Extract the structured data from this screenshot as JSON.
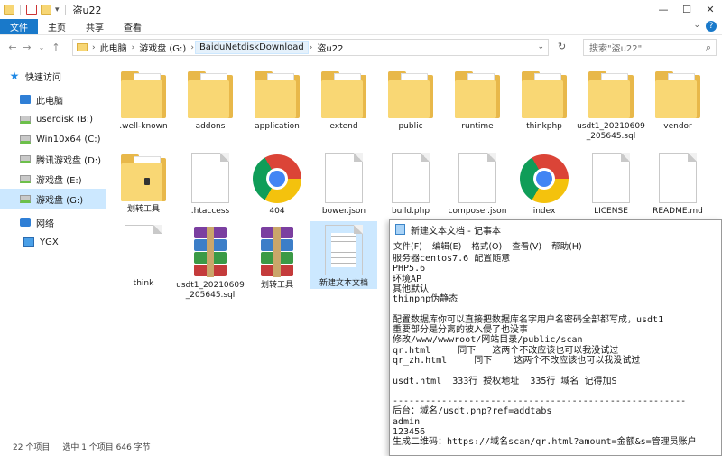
{
  "window": {
    "title": "盗u22",
    "controls": [
      "—",
      "☐",
      "✕"
    ]
  },
  "ribbon": {
    "tabs": [
      "文件",
      "主页",
      "共享",
      "查看"
    ],
    "help": "?"
  },
  "address": {
    "crumbs": [
      "此电脑",
      "游戏盘 (G:)",
      "BaiduNetdiskDownload",
      "盗u22"
    ],
    "search_placeholder": "搜索\"盗u22\""
  },
  "sidebar": {
    "items": [
      {
        "label": "快速访问",
        "icon": "star-icon"
      },
      {
        "label": "此电脑",
        "icon": "computer-icon"
      },
      {
        "label": "userdisk (B:)",
        "icon": "drive-icon"
      },
      {
        "label": "Win10x64 (C:)",
        "icon": "drive-icon"
      },
      {
        "label": "腾讯游戏盘 (D:)",
        "icon": "drive-icon"
      },
      {
        "label": "游戏盘 (E:)",
        "icon": "drive-icon"
      },
      {
        "label": "游戏盘 (G:)",
        "icon": "drive-icon"
      },
      {
        "label": "网络",
        "icon": "network-icon"
      },
      {
        "label": "YGX",
        "icon": "monitor-icon"
      }
    ]
  },
  "files": [
    {
      "name": ".well-known",
      "type": "folder"
    },
    {
      "name": "addons",
      "type": "folder"
    },
    {
      "name": "application",
      "type": "folder"
    },
    {
      "name": "extend",
      "type": "folder"
    },
    {
      "name": "public",
      "type": "folder"
    },
    {
      "name": "runtime",
      "type": "folder"
    },
    {
      "name": "thinkphp",
      "type": "folder"
    },
    {
      "name": "usdt1_20210609_205645.sql",
      "type": "folder"
    },
    {
      "name": "vendor",
      "type": "folder"
    },
    {
      "name": "划转工具",
      "type": "folder-dark"
    },
    {
      "name": ".htaccess",
      "type": "doc"
    },
    {
      "name": "404",
      "type": "chrome"
    },
    {
      "name": "bower.json",
      "type": "doc"
    },
    {
      "name": "build.php",
      "type": "doc"
    },
    {
      "name": "composer.json",
      "type": "doc"
    },
    {
      "name": "index",
      "type": "chrome"
    },
    {
      "name": "LICENSE",
      "type": "doc"
    },
    {
      "name": "README.md",
      "type": "doc"
    },
    {
      "name": "think",
      "type": "doc"
    },
    {
      "name": "usdt1_20210609_205645.sql",
      "type": "rar"
    },
    {
      "name": "划转工具",
      "type": "rar"
    },
    {
      "name": "新建文本文档",
      "type": "txt"
    }
  ],
  "status": {
    "count": "22 个项目",
    "selection": "选中 1 个项目  646 字节"
  },
  "notepad": {
    "title": "新建文本文档 - 记事本",
    "menu": [
      "文件(F)",
      "编辑(E)",
      "格式(O)",
      "查看(V)",
      "帮助(H)"
    ],
    "lines": [
      "服务器centos7.6 配置随意",
      "PHP5.6",
      "环境AP",
      "其他默认",
      "thinphp伪静态",
      "",
      "配置数据库你可以直接把数据库名字用户名密码全部都写成，usdt1",
      "重要部分是分离的被入侵了也没事",
      "修改/www/wwwroot/网站目录/public/scan",
      "qr.html     同下   这两个不改应该也可以我没试过",
      "qr_zh.html     同下    这两个不改应该也可以我没试过",
      "",
      "usdt.html  333行 授权地址  335行 域名 记得加S",
      "",
      "------------------------------------------------------",
      "后台：域名/usdt.php?ref=addtabs",
      "admin",
      "123456",
      "生成二维码：https://域名scan/qr.html?amount=金额&s=管理员账户"
    ]
  }
}
